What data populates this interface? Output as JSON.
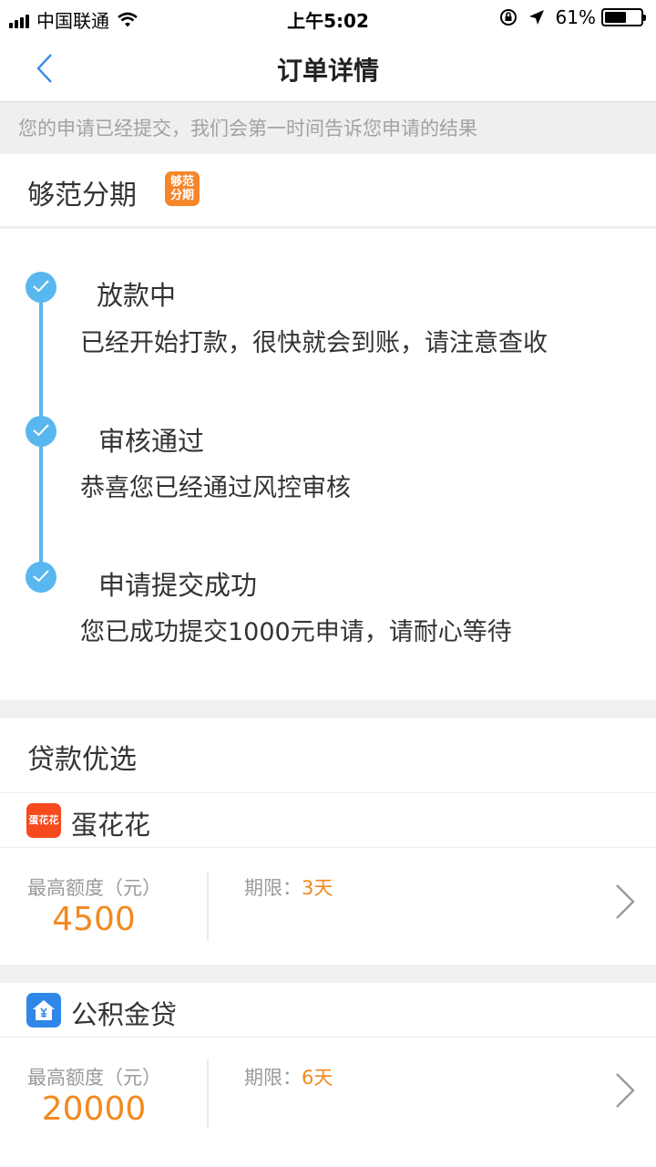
{
  "status_bar": {
    "carrier": "中国联通",
    "time": "上午5:02",
    "battery": "61%",
    "battery_level": 0.61
  },
  "nav": {
    "title": "订单详情"
  },
  "notice": "您的申请已经提交，我们会第一时间告诉您申请的结果",
  "provider": {
    "name": "够范分期",
    "logo_text_1": "够范",
    "logo_text_2": "分期"
  },
  "timeline": [
    {
      "title": "放款中",
      "desc": "已经开始打款，很快就会到账，请注意查收"
    },
    {
      "title": "审核通过",
      "desc": "恭喜您已经通过风控审核"
    },
    {
      "title": "申请提交成功",
      "desc": "您已成功提交1000元申请，请耐心等待"
    }
  ],
  "loans": {
    "title": "贷款优选",
    "items": [
      {
        "name": "蛋花花",
        "logo_text": "蛋花花",
        "limit_label": "最高额度（元）",
        "amount": "4500",
        "term_label": "期限：",
        "term_value": "3天"
      },
      {
        "name": "公积金贷",
        "limit_label": "最高额度（元）",
        "amount": "20000",
        "term_label": "期限：",
        "term_value": "6天"
      }
    ]
  },
  "colors": {
    "accent_blue": "#58b7ef",
    "accent_orange": "#f08a1f"
  }
}
